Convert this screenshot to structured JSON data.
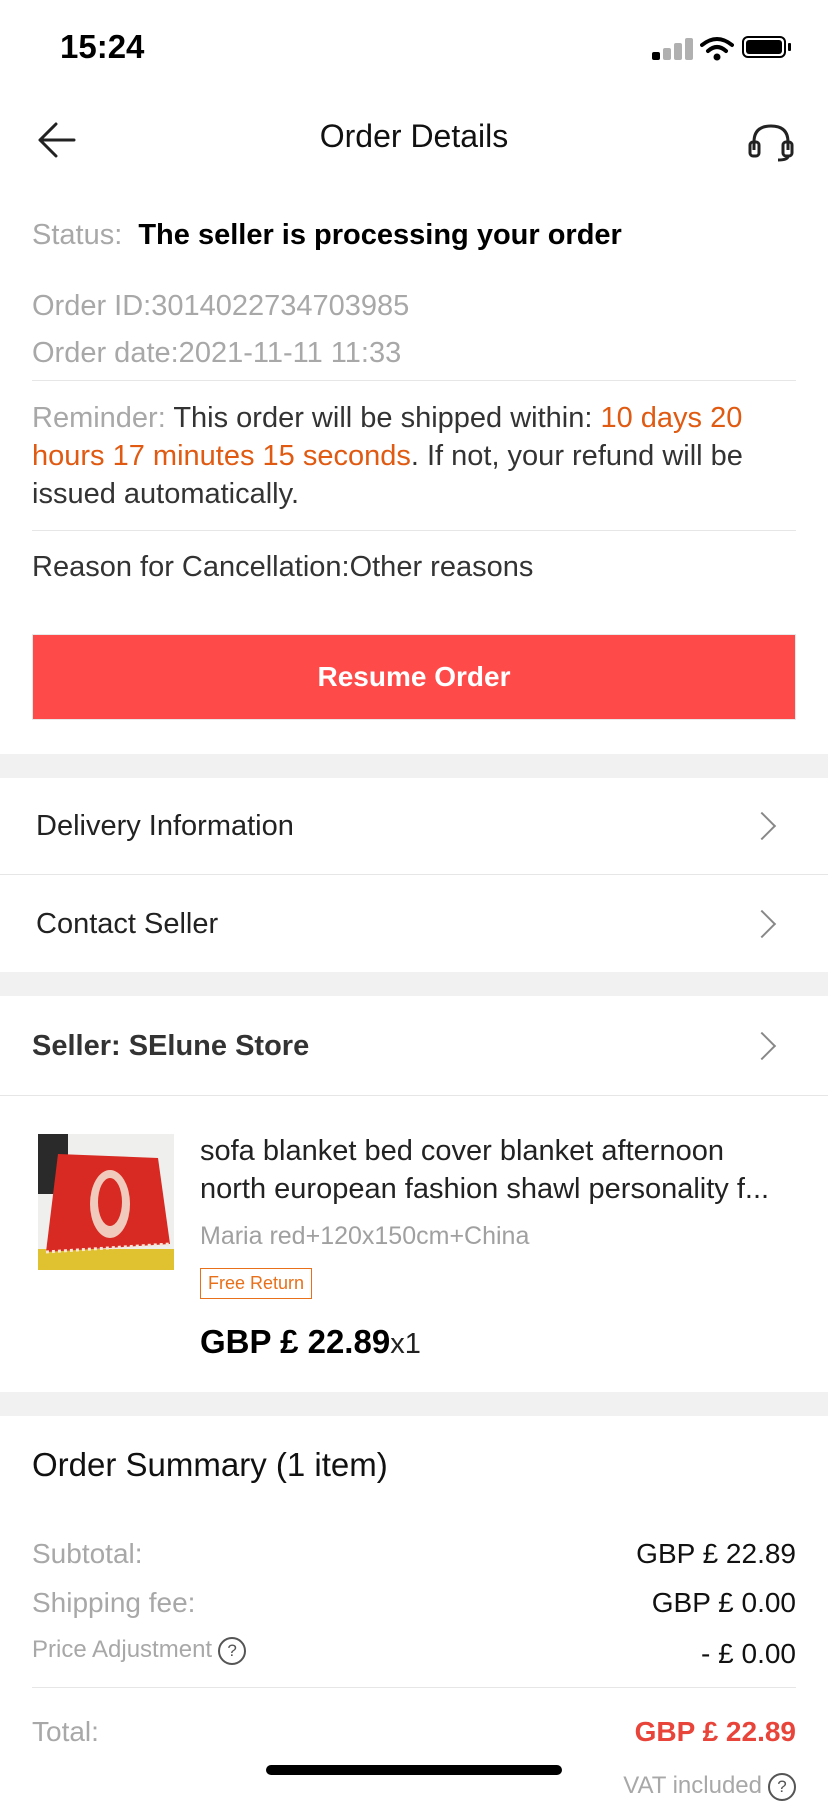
{
  "status_bar": {
    "time": "15:24"
  },
  "header": {
    "title": "Order Details"
  },
  "order": {
    "status_label": "Status:",
    "status_value": "The seller is processing your order",
    "order_id": "Order ID:3014022734703985",
    "order_date": "Order date:2021-11-11 11:33",
    "reminder_label": "Reminder:",
    "reminder_text1": "This order will be shipped within:",
    "reminder_countdown": "10 days 20 hours 17 minutes 15 seconds",
    "reminder_text2": ". If not, your refund will be issued automatically.",
    "cancel_reason": "Reason for Cancellation:Other reasons",
    "resume_button": "Resume Order"
  },
  "menu": {
    "delivery": "Delivery Information",
    "contact": "Contact Seller"
  },
  "seller": {
    "label": "Seller: SElune Store"
  },
  "product": {
    "title": "sofa blanket bed cover blanket afternoon north european fashion shawl personality f...",
    "variant": "Maria red+120x150cm+China",
    "badge": "Free Return",
    "price": "GBP  £ 22.89",
    "qty": "x1"
  },
  "summary": {
    "title": "Order Summary (1 item)",
    "subtotal_label": "Subtotal:",
    "subtotal_value": "GBP  £ 22.89",
    "shipping_label": "Shipping fee:",
    "shipping_value": "GBP  £ 0.00",
    "adjustment_label": "Price Adjustment",
    "adjustment_value": "- £ 0.00",
    "total_label": "Total:",
    "total_value": "GBP  £ 22.89",
    "vat_note": "VAT included"
  },
  "colors": {
    "accent_red": "#ff4a4a",
    "countdown_orange": "#e05a12",
    "total_red": "#e8443a"
  },
  "icons": [
    "back-arrow-icon",
    "customer-service-icon",
    "chevron-right-icon",
    "help-circle-icon"
  ]
}
